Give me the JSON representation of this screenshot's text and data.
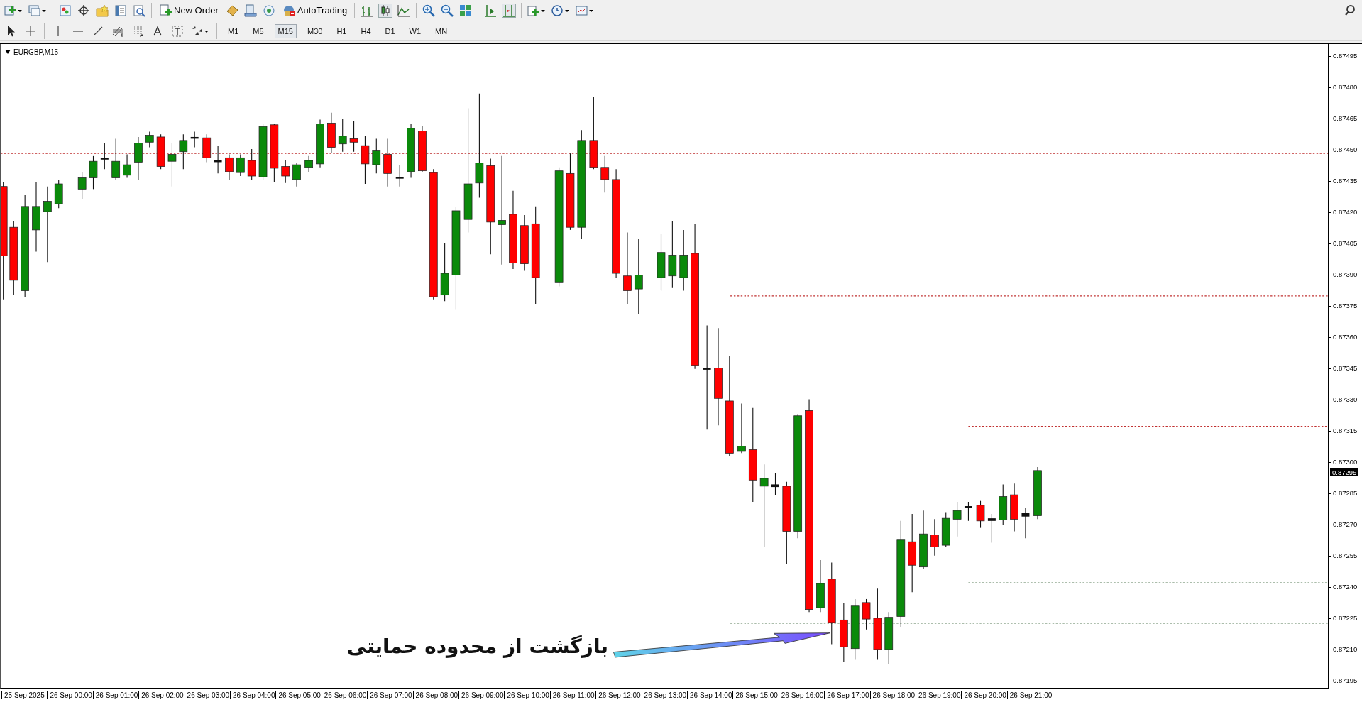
{
  "toolbar": {
    "buttons": [
      {
        "kind": "new-order",
        "label": "New Order"
      },
      {
        "kind": "auto-trading",
        "label": "AutoTrading"
      }
    ]
  },
  "timeframes": [
    {
      "label": "M1",
      "selected": false
    },
    {
      "label": "M5",
      "selected": false
    },
    {
      "label": "M15",
      "selected": true
    },
    {
      "label": "M30",
      "selected": false
    },
    {
      "label": "H1",
      "selected": false
    },
    {
      "label": "H4",
      "selected": false
    },
    {
      "label": "D1",
      "selected": false
    },
    {
      "label": "W1",
      "selected": false
    },
    {
      "label": "MN",
      "selected": false
    }
  ],
  "chart": {
    "title": "EURGBP,M15",
    "price_labels": [
      "0.87495",
      "0.87480",
      "0.87465",
      "0.87450",
      "0.87435",
      "0.87420",
      "0.87405",
      "0.87390",
      "0.87375",
      "0.87360",
      "0.87345",
      "0.87330",
      "0.87315",
      "0.87300",
      "0.87285",
      "0.87270",
      "0.87255",
      "0.87240",
      "0.87225",
      "0.87210",
      "0.87195"
    ],
    "current_price": "0.87295",
    "time_labels": [
      "25 Sep 2025",
      "26 Sep 00:00",
      "26 Sep 01:00",
      "26 Sep 02:00",
      "26 Sep 03:00",
      "26 Sep 04:00",
      "26 Sep 05:00",
      "26 Sep 06:00",
      "26 Sep 07:00",
      "26 Sep 08:00",
      "26 Sep 09:00",
      "26 Sep 10:00",
      "26 Sep 11:00",
      "26 Sep 12:00",
      "26 Sep 13:00",
      "26 Sep 14:00",
      "26 Sep 15:00",
      "26 Sep 16:00",
      "26 Sep 17:00",
      "26 Sep 18:00",
      "26 Sep 19:00",
      "26 Sep 20:00",
      "26 Sep 21:00"
    ],
    "annotation": "بازگشت از محدوده حمایتی"
  }
}
